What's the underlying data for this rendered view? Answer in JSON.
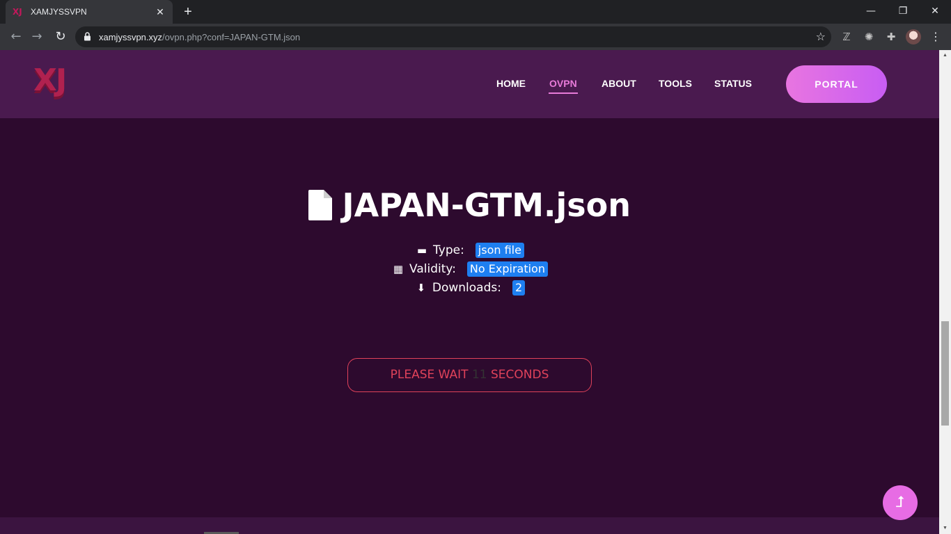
{
  "browser": {
    "tab_title": "XAMJYSSVPN",
    "tab_favicon_text": "XJ",
    "url_domain": "xamjyssvpn.xyz",
    "url_path": "/ovpn.php?conf=JAPAN-GTM.json",
    "icons": [
      "back-icon",
      "forward-icon",
      "reload-icon",
      "lock-icon",
      "star-icon",
      "z-extension-icon",
      "circle-extension-icon",
      "puzzle-extensions-icon",
      "profile-avatar",
      "menu-dots-icon"
    ]
  },
  "header": {
    "logo_text": "XJ",
    "nav": [
      "HOME",
      "OVPN",
      "ABOUT",
      "TOOLS",
      "STATUS"
    ],
    "active_nav": "OVPN",
    "portal_label": "PORTAL"
  },
  "file": {
    "name": "JAPAN-GTM.json",
    "type_label": "Type:",
    "type_value": "json file",
    "validity_label": "Validity:",
    "validity_value": "No Expiration",
    "downloads_label": "Downloads:",
    "downloads_value": "2"
  },
  "wait": {
    "prefix": "PLEASE WAIT",
    "seconds": "11",
    "suffix": "SECONDS"
  },
  "colors": {
    "page_bg": "#2d0a2e",
    "header_bg": "#4a1a4f",
    "accent_pink": "#e87bd9",
    "badge_blue": "#1e7ff0",
    "wait_red": "#e0425a"
  }
}
